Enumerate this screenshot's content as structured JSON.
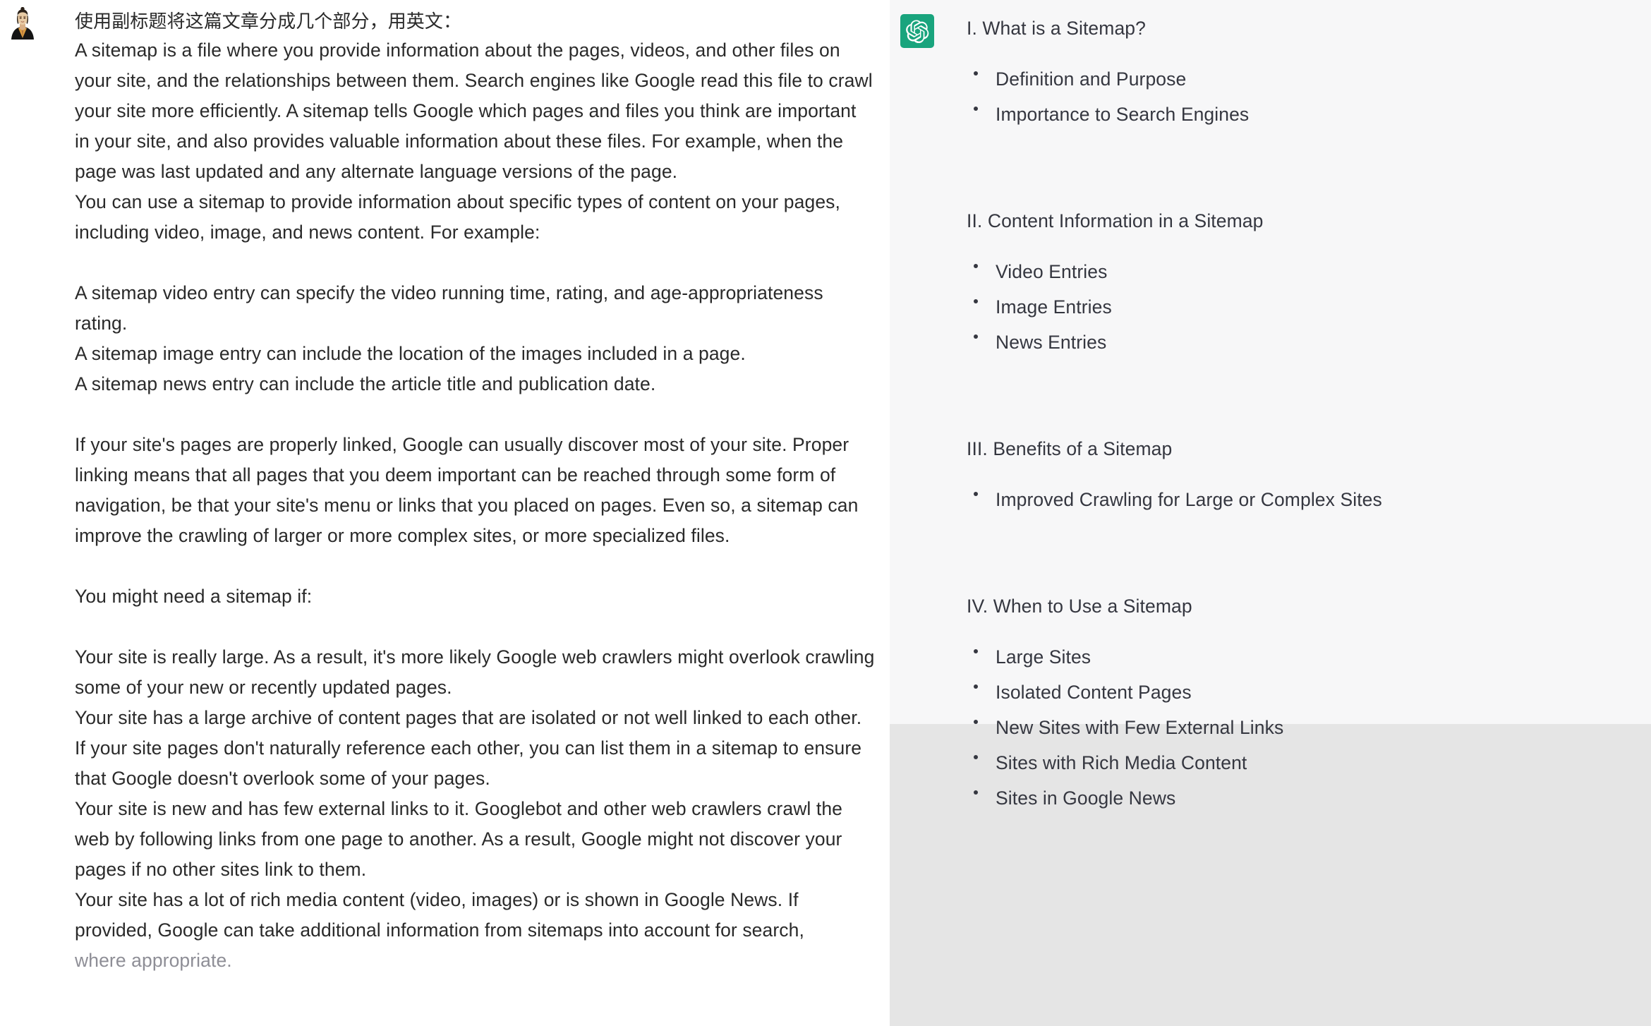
{
  "left_message": {
    "role_label": "user",
    "avatar_icon": "user-avatar-photo",
    "instruction": "使用副标题将这篇文章分成几个部分，用英文：",
    "paragraphs": [
      "A sitemap is a file where you provide information about the pages, videos, and other files on your site, and the relationships between them. Search engines like Google read this file to crawl your site more efficiently. A sitemap tells Google which pages and files you think are important in your site, and also provides valuable information about these files. For example, when the page was last updated and any alternate language versions of the page.",
      "You can use a sitemap to provide information about specific types of content on your pages, including video, image, and news content. For example:",
      "A sitemap video entry can specify the video running time, rating, and age-appropriateness rating.",
      "A sitemap image entry can include the location of the images included in a page.",
      "A sitemap news entry can include the article title and publication date.",
      "If your site's pages are properly linked, Google can usually discover most of your site. Proper linking means that all pages that you deem important can be reached through some form of navigation, be that your site's menu or links that you placed on pages. Even so, a sitemap can improve the crawling of larger or more complex sites, or more specialized files.",
      "You might need a sitemap if:",
      "Your site is really large. As a result, it's more likely Google web crawlers might overlook crawling some of your new or recently updated pages.",
      "Your site has a large archive of content pages that are isolated or not well linked to each other. If your site pages don't naturally reference each other, you can list them in a sitemap to ensure that Google doesn't overlook some of your pages.",
      "Your site is new and has few external links to it. Googlebot and other web crawlers crawl the web by following links from one page to another. As a result, Google might not discover your pages if no other sites link to them.",
      "Your site has a lot of rich media content (video, images) or is shown in Google News. If provided, Google can take additional information from sitemaps into account for search,",
      "where appropriate."
    ]
  },
  "right_message": {
    "role_label": "assistant",
    "avatar_icon": "chatgpt-logo-icon",
    "brand_color": "#19a47d",
    "panel_bg": "#f7f7f8",
    "footer_bg": "#e5e5e5",
    "sections": [
      {
        "heading": "I. What is a Sitemap?",
        "items": [
          "Definition and Purpose",
          "Importance to Search Engines"
        ]
      },
      {
        "heading": "II. Content Information in a Sitemap",
        "items": [
          "Video Entries",
          "Image Entries",
          "News Entries"
        ]
      },
      {
        "heading": "III. Benefits of a Sitemap",
        "items": [
          "Improved Crawling for Large or Complex Sites"
        ]
      },
      {
        "heading": "IV. When to Use a Sitemap",
        "items": [
          "Large Sites",
          "Isolated Content Pages",
          "New Sites with Few External Links",
          "Sites with Rich Media Content",
          "Sites in Google News"
        ]
      }
    ]
  }
}
